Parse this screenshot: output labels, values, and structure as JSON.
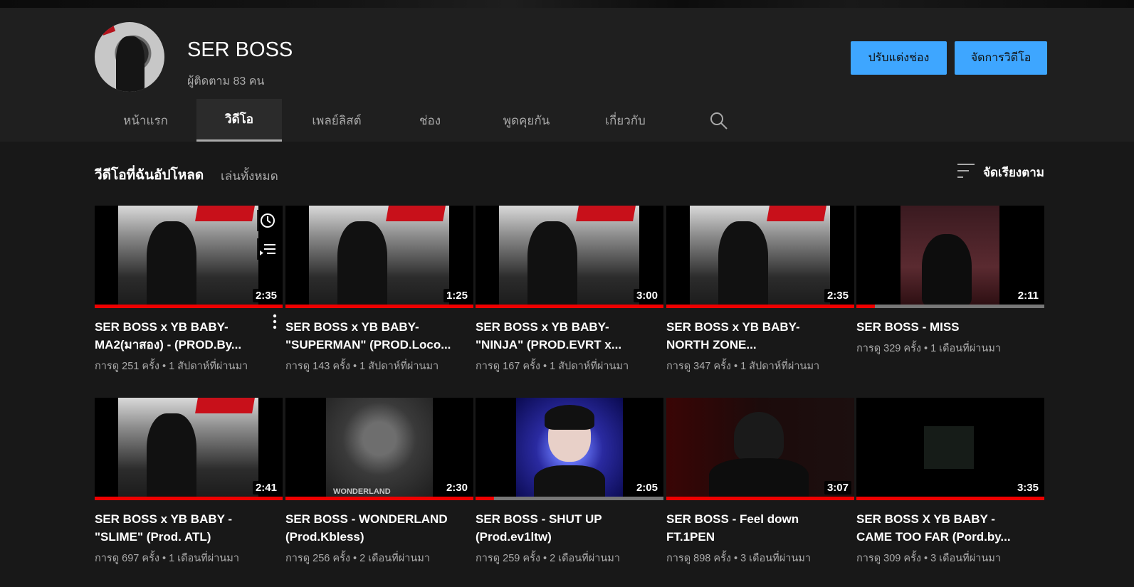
{
  "channel": {
    "name": "SER BOSS",
    "subscribers": "ผู้ติดตาม 83 คน",
    "customize_label": "ปรับแต่งช่อง",
    "manage_label": "จัดการวิดีโอ"
  },
  "tabs": [
    {
      "label": "หน้าแรก",
      "active": false
    },
    {
      "label": "วิดีโอ",
      "active": true
    },
    {
      "label": "เพลย์ลิสต์",
      "active": false
    },
    {
      "label": "ช่อง",
      "active": false
    },
    {
      "label": "พูดคุยกัน",
      "active": false
    },
    {
      "label": "เกี่ยวกับ",
      "active": false
    }
  ],
  "section": {
    "title": "วีดีโอที่ฉันอัปโหลด",
    "play_all": "เล่นทั้งหมด",
    "sort_label": "จัดเรียงตาม"
  },
  "videos": [
    {
      "title": "SER BOSS x YB BABY- MA2(มาสอง) - (PROD.By...",
      "meta": "การดู 251 ครั้ง • 1 สัปดาห์ที่ผ่านมา",
      "duration": "2:35",
      "progress": 1.0,
      "thumb": "red-poster"
    },
    {
      "title": "SER BOSS x YB BABY- \"SUPERMAN\" (PROD.Loco...",
      "meta": "การดู 143 ครั้ง • 1 สัปดาห์ที่ผ่านมา",
      "duration": "1:25",
      "progress": 1.0,
      "thumb": "red-poster"
    },
    {
      "title": "SER BOSS x YB BABY- \"NINJA\" (PROD.EVRT x...",
      "meta": "การดู 167 ครั้ง • 1 สัปดาห์ที่ผ่านมา",
      "duration": "3:00",
      "progress": 1.0,
      "thumb": "red-poster"
    },
    {
      "title": "SER BOSS x YB BABY- NORTH ZONE...",
      "meta": "การดู 347 ครั้ง • 1 สัปดาห์ที่ผ่านมา",
      "duration": "2:35",
      "progress": 1.0,
      "thumb": "red-poster"
    },
    {
      "title": "SER BOSS - MISS",
      "meta": "การดู 329 ครั้ง • 1 เดือนที่ผ่านมา",
      "duration": "2:11",
      "progress": 0.1,
      "thumb": "hug"
    },
    {
      "title": "SER BOSS x YB BABY - \"SLIME\" (Prod. ATL)",
      "meta": "การดู 697 ครั้ง • 1 เดือนที่ผ่านมา",
      "duration": "2:41",
      "progress": 1.0,
      "thumb": "red-poster"
    },
    {
      "title": "SER BOSS - WONDERLAND (Prod.Kbless)",
      "meta": "การดู 256 ครั้ง • 2 เดือนที่ผ่านมา",
      "duration": "2:30",
      "progress": 1.0,
      "thumb": "wonderland"
    },
    {
      "title": "SER BOSS - SHUT UP (Prod.ev1ltw)",
      "meta": "การดู 259 ครั้ง • 2 เดือนที่ผ่านมา",
      "duration": "2:05",
      "progress": 0.1,
      "thumb": "blue-face"
    },
    {
      "title": "SER BOSS - Feel down FT.1PEN",
      "meta": "การดู 898 ครั้ง • 3 เดือนที่ผ่านมา",
      "duration": "3:07",
      "progress": 1.0,
      "thumb": "dark-red"
    },
    {
      "title": "SER BOSS X YB BABY - CAME TOO FAR (Pord.by...",
      "meta": "การดู 309 ครั้ง • 3 เดือนที่ผ่านมา",
      "duration": "3:35",
      "progress": 1.0,
      "thumb": "dark"
    }
  ],
  "colors": {
    "accent": "#3ea6ff",
    "progress": "#ee0000",
    "background": "#181818"
  }
}
